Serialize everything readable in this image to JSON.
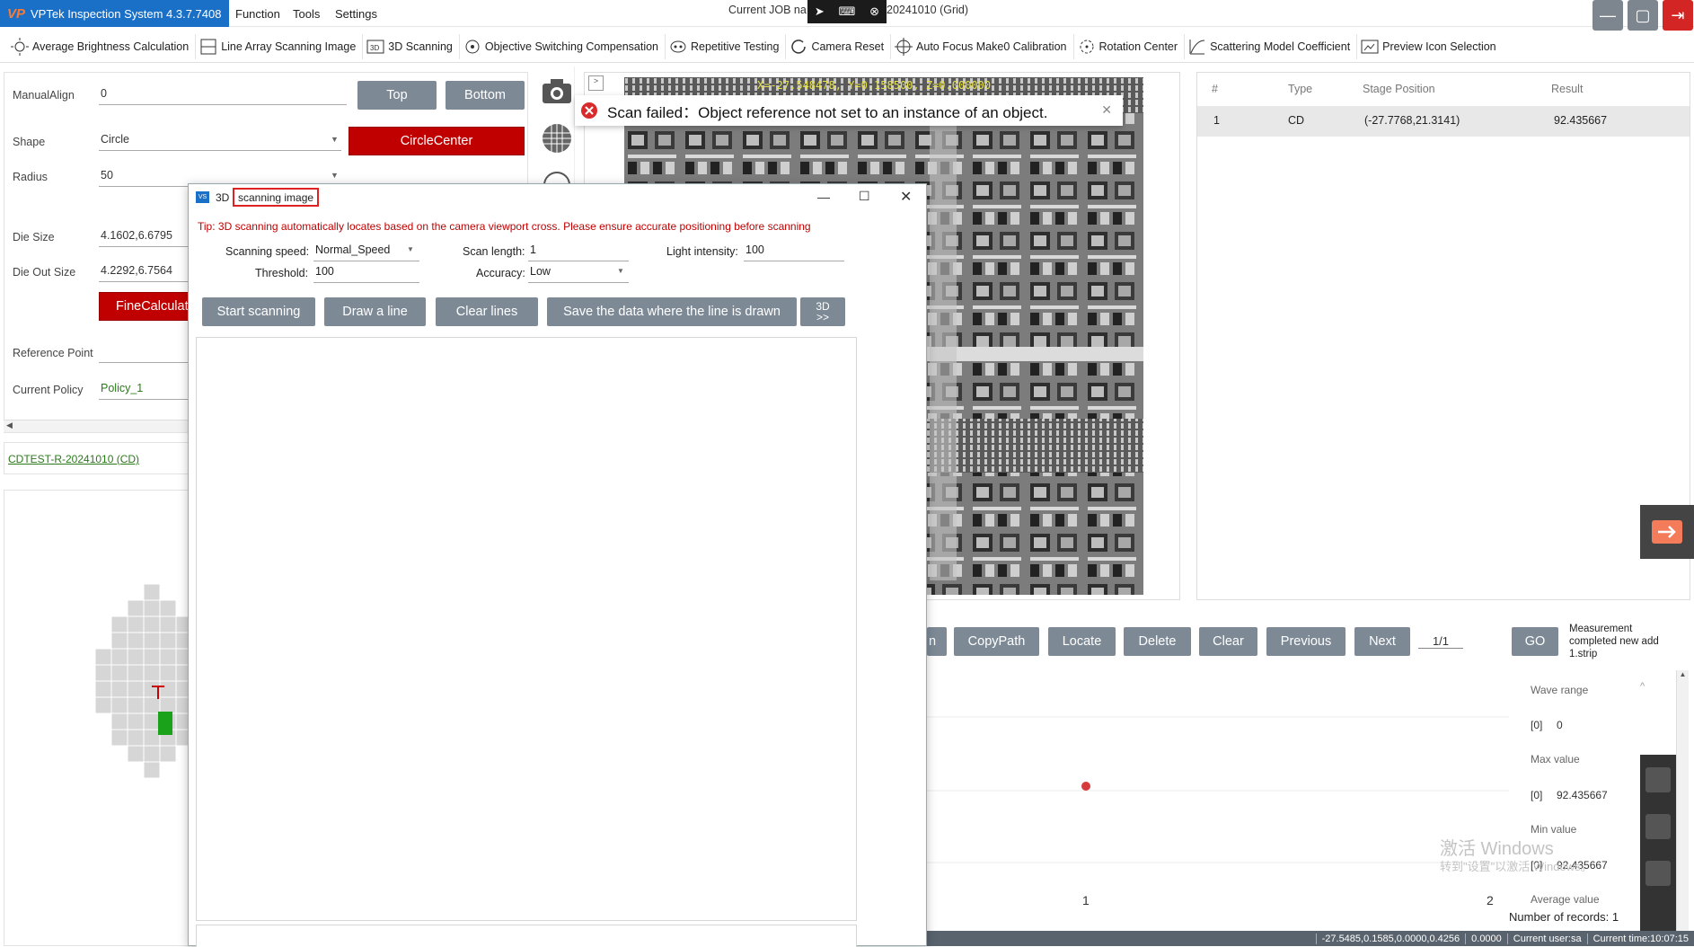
{
  "app": {
    "title": "VPTek Inspection System 4.3.7.7408",
    "logo": "VP"
  },
  "menu": [
    "Function",
    "Tools",
    "Settings"
  ],
  "job": {
    "prefix": "Current JOB na",
    "suffix": "20241010 (Grid)"
  },
  "toolbar": [
    {
      "label": "Average Brightness Calculation",
      "icon": "brightness-icon"
    },
    {
      "label": "Line Array Scanning Image",
      "icon": "line-scan-icon"
    },
    {
      "label": "3D Scanning",
      "icon": "3d-icon"
    },
    {
      "label": "Objective Switching Compensation",
      "icon": "objective-icon"
    },
    {
      "label": "Repetitive Testing",
      "icon": "repeat-icon"
    },
    {
      "label": "Camera Reset",
      "icon": "reset-icon"
    },
    {
      "label": "Auto Focus Make0 Calibration",
      "icon": "focus-icon"
    },
    {
      "label": "Rotation Center",
      "icon": "rotation-icon"
    },
    {
      "label": "Scattering Model Coefficient",
      "icon": "scatter-icon"
    },
    {
      "label": "Preview Icon Selection",
      "icon": "preview-icon"
    }
  ],
  "left": {
    "manualalign_label": "ManualAlign",
    "manualalign_value": "0",
    "top_btn": "Top",
    "bottom_btn": "Bottom",
    "shape_label": "Shape",
    "shape_value": "Circle",
    "circlecenter_btn": "CircleCenter",
    "radius_label": "Radius",
    "radius_value": "50",
    "diesize_label": "Die Size",
    "diesize_value": "4.1602,6.6795",
    "dieout_label": "Die Out Size",
    "dieout_value": "4.2292,6.7564",
    "finecalc_btn": "FineCalculat",
    "refpoint_label": "Reference Point",
    "policy_label": "Current Policy",
    "policy_value": "Policy_1",
    "recipe_link": "CDTEST-R-20241010 (CD)"
  },
  "toast": {
    "message": "Scan failed：Object reference not set to an instance of an object."
  },
  "overlay_text": "X=-27.548478, Y=0.158500, Z=0.000000",
  "dialog": {
    "title_prefix": "3D",
    "title_boxed": "scanning image",
    "tip": "Tip: 3D scanning automatically locates based on the camera viewport cross. Please ensure accurate positioning before scanning",
    "speed_label": "Scanning speed:",
    "speed_value": "Normal_Speed",
    "length_label": "Scan length:",
    "length_value": "1",
    "light_label": "Light intensity:",
    "light_value": "100",
    "threshold_label": "Threshold:",
    "threshold_value": "100",
    "accuracy_label": "Accuracy:",
    "accuracy_value": "Low",
    "btn_start": "Start scanning",
    "btn_draw": "Draw a line",
    "btn_clear": "Clear lines",
    "btn_save": "Save the data where the line is drawn",
    "btn_3d_top": "3D",
    "btn_3d_bottom": ">>"
  },
  "table": {
    "headers": [
      "#",
      "Type",
      "Stage Position",
      "Result"
    ],
    "rows": [
      [
        "1",
        "CD",
        "(-27.7768,21.3141)",
        "92.435667"
      ]
    ]
  },
  "actions": {
    "partial": "n",
    "copypath": "CopyPath",
    "locate": "Locate",
    "delete": "Delete",
    "clear": "Clear",
    "previous": "Previous",
    "next": "Next",
    "page": "1/1",
    "go": "GO",
    "status_msg": "Measurement completed new add 1.strip"
  },
  "stats": {
    "wave_range": "Wave range",
    "wave_idx": "[0]",
    "wave_val": "0",
    "max_label": "Max value",
    "max_idx": "[0]",
    "max_val": "92.435667",
    "min_label": "Min value",
    "min_idx": "[0]",
    "min_val": "92.435667",
    "avg_label": "Average value",
    "records": "Number of records: 1"
  },
  "plot": {
    "xtick1": "1",
    "xtick2": "2",
    "point_color": "#d63a3a"
  },
  "watermark": {
    "line1": "激活 Windows",
    "line2": "转到\"设置\"以激活 Windows。"
  },
  "statusbar": [
    "-27.5485,0.1585,0.0000,0.4256",
    "0.0000",
    "Current user:sa",
    "Current time:10:07:15"
  ],
  "colors": {
    "accent_blue": "#1a6fc7",
    "red_btn": "#c00000",
    "grey_btn": "#7d8a96",
    "link_green": "#2a7a1a",
    "tip_red": "#c00000"
  }
}
